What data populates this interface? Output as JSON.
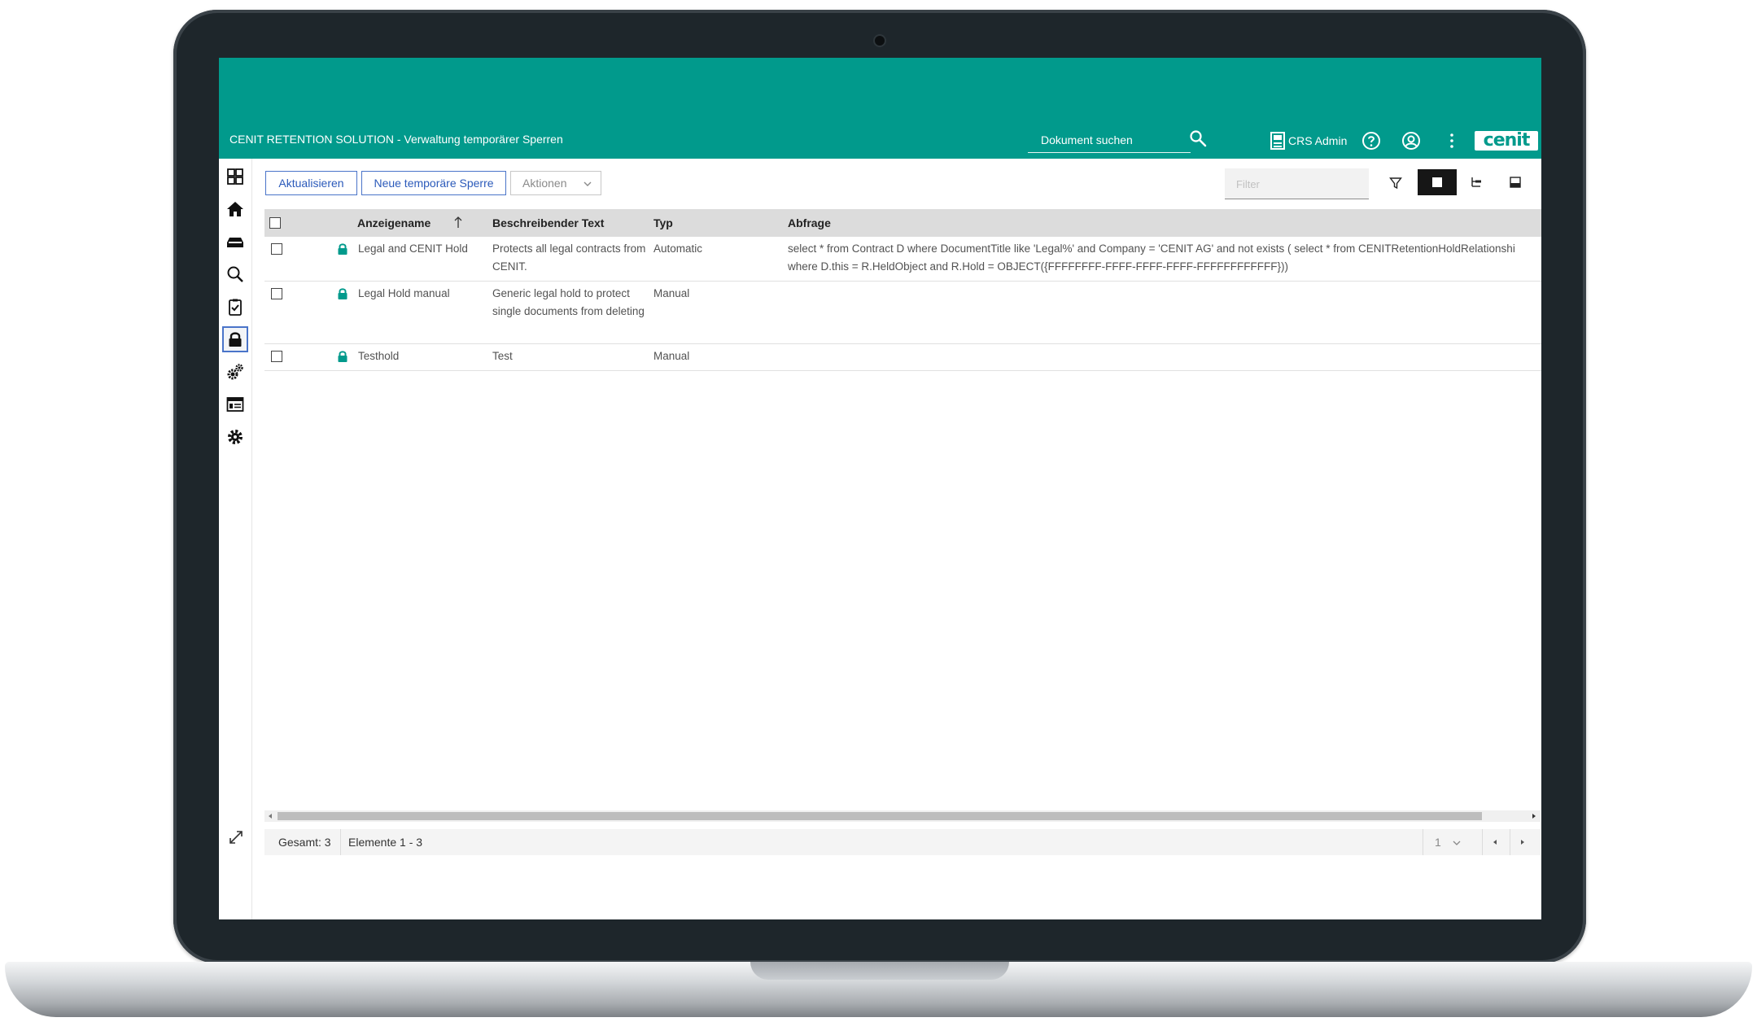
{
  "header": {
    "app_title": "CENIT RETENTION SOLUTION - Verwaltung temporärer Sperren",
    "search_placeholder": "Dokument suchen",
    "user_name": "CRS Admin",
    "logo_text": "cenit",
    "brand_color": "#019a8c"
  },
  "leftnav": {
    "items": [
      {
        "icon": "dashboard-icon"
      },
      {
        "icon": "home-icon"
      },
      {
        "icon": "inbox-icon"
      },
      {
        "icon": "search-icon"
      },
      {
        "icon": "clipboard-check-icon"
      },
      {
        "icon": "lock-icon",
        "active": true
      },
      {
        "icon": "gears-icon"
      },
      {
        "icon": "form-icon"
      },
      {
        "icon": "settings-gear-icon"
      }
    ],
    "expand_icon": "expand-icon"
  },
  "toolbar": {
    "refresh_label": "Aktualisieren",
    "new_hold_label": "Neue temporäre Sperre",
    "actions_label": "Aktionen",
    "filter_placeholder": "Filter",
    "view_modes": [
      "details-view",
      "tree-view",
      "magazine-view"
    ],
    "active_view": "details-view"
  },
  "table": {
    "columns": [
      "Anzeigename",
      "Beschreibender Text",
      "Typ",
      "Abfrage"
    ],
    "sort_column": "Anzeigename",
    "sort_direction": "ascending",
    "rows": [
      {
        "name": "Legal and CENIT Hold",
        "description": "Protects all legal contracts from CENIT.",
        "type": "Automatic",
        "query": "select * from Contract D where DocumentTitle like 'Legal%' and Company = 'CENIT AG' and not exists ( select * from CENITRetentionHoldRelationshi\nwhere D.this = R.HeldObject and R.Hold = OBJECT({FFFFFFFF-FFFF-FFFF-FFFF-FFFFFFFFFFFF}))"
      },
      {
        "name": "Legal Hold manual",
        "description": "Generic legal hold to protect single documents from deleting",
        "type": "Manual",
        "query": ""
      },
      {
        "name": "Testhold",
        "description": "Test",
        "type": "Manual",
        "query": ""
      }
    ]
  },
  "footer": {
    "total": "Gesamt: 3",
    "items": "Elemente 1 - 3",
    "page": "1"
  }
}
